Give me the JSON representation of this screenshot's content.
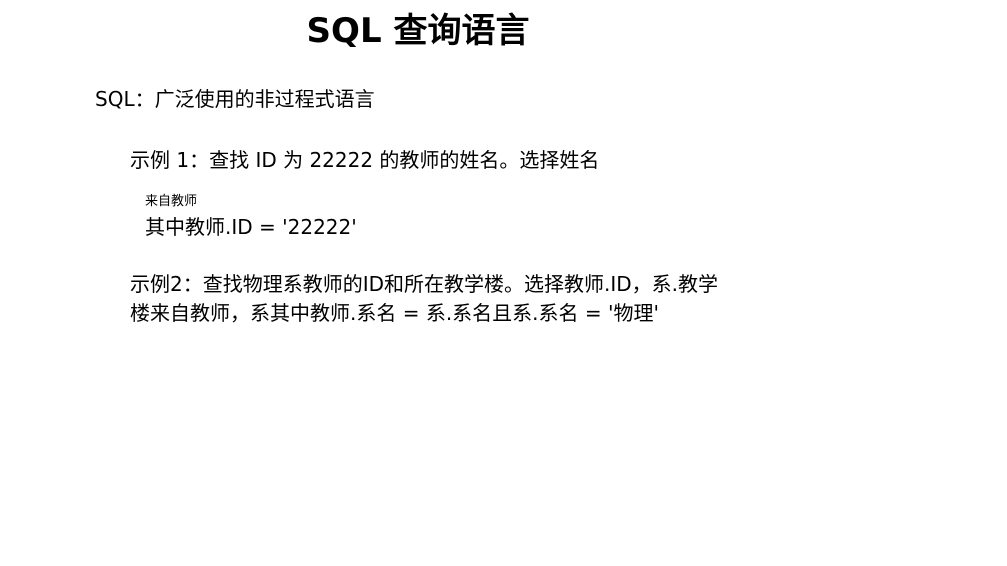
{
  "title": "SQL 查询语言",
  "intro": "SQL：广泛使用的非过程式语言",
  "example1": {
    "line": "示例 1：查找 ID 为 22222 的教师的姓名。选择姓名",
    "from": "来自教师",
    "where": "其中教师.ID = '22222'"
  },
  "example2": {
    "line1": "示例2：查找物理系教师的ID和所在教学楼。选择教师.ID，系.教学",
    "line2": "楼来自教师，系其中教师.系名 = 系.系名且系.系名 = '物理'"
  }
}
